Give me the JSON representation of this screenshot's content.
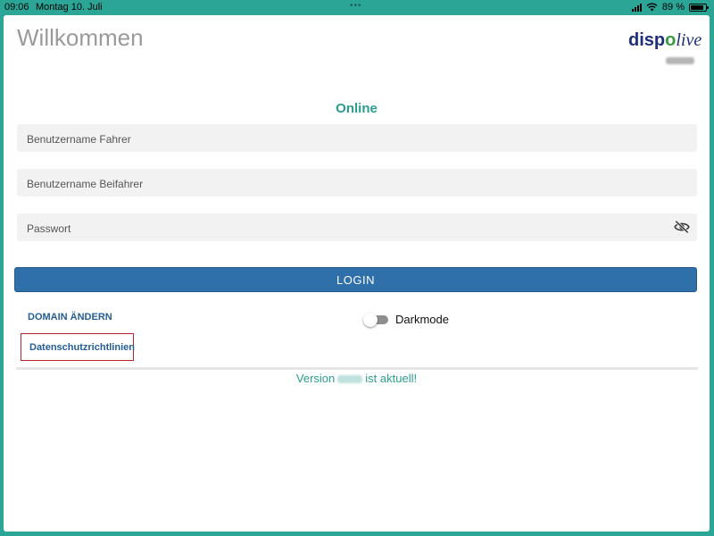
{
  "statusbar": {
    "time": "09:06",
    "date": "Montag 10. Juli",
    "battery": "89 %",
    "battery_level": 0.89
  },
  "header": {
    "title": "Willkommen",
    "logo": {
      "part1": "disp",
      "part2": "o",
      "part3": "live"
    }
  },
  "status": {
    "connection": "Online"
  },
  "form": {
    "driver_placeholder": "Benutzername Fahrer",
    "codriver_placeholder": "Benutzername Beifahrer",
    "password_placeholder": "Passwort",
    "login_label": "LOGIN"
  },
  "links": {
    "domain_label": "DOMAIN ÄNDERN",
    "privacy_label": "Datenschutzrichtlinien"
  },
  "darkmode": {
    "label": "Darkmode",
    "enabled": false
  },
  "footer": {
    "version_prefix": "Version",
    "version_suffix": "ist aktuell!"
  },
  "colors": {
    "frame": "#2aa596",
    "accent": "#2a9d8f",
    "button": "#2f70aa",
    "link": "#245e94",
    "highlight": "#b3252b"
  },
  "icons": {
    "password_toggle": "eye-off-icon",
    "wifi": "wifi-icon",
    "signal": "signal-icon",
    "battery": "battery-icon"
  }
}
